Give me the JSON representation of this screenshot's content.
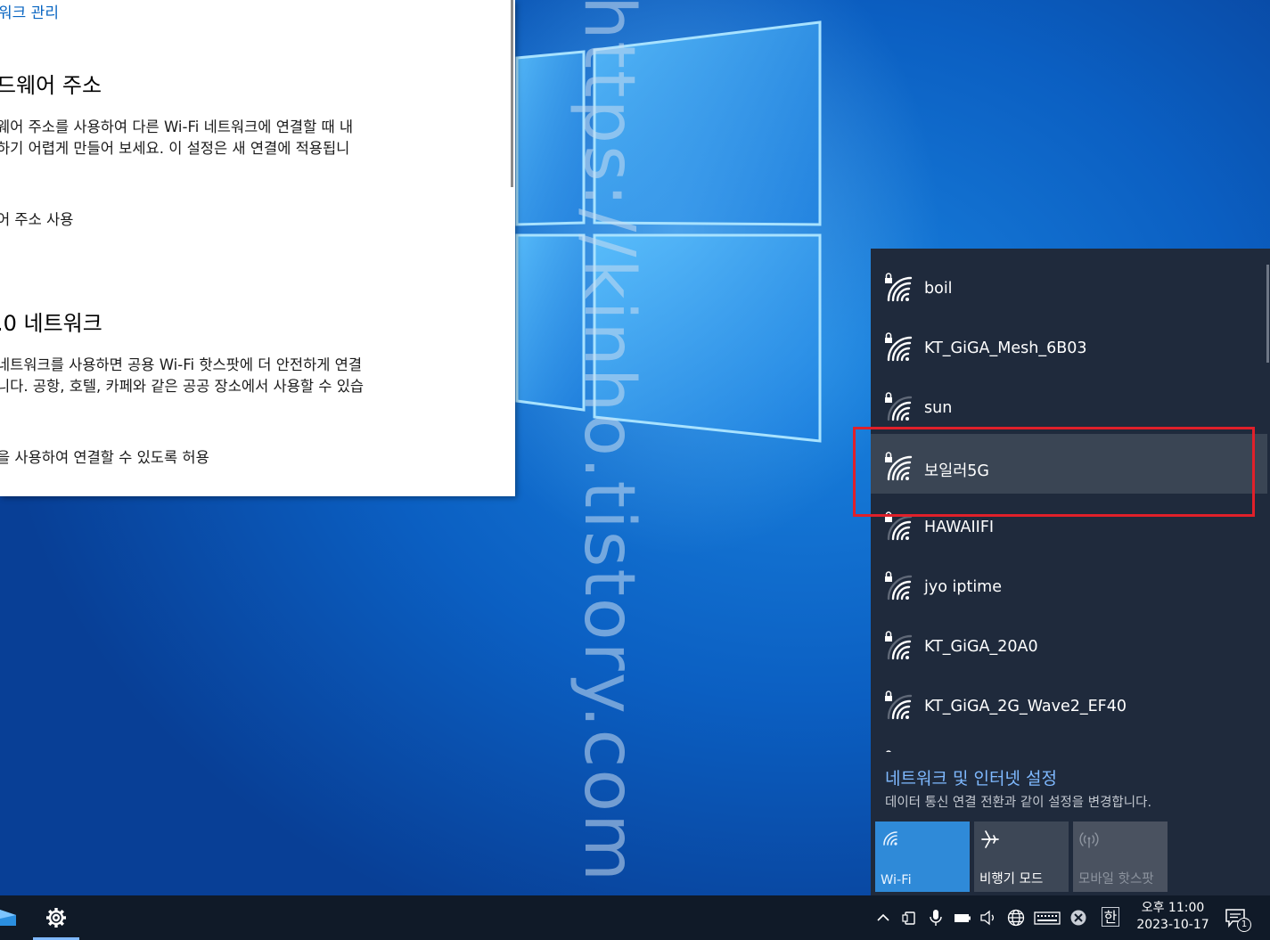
{
  "settings_window": {
    "link": "워크 관리",
    "section1": {
      "title": "드웨어 주소",
      "desc_line1": "웨어 주소를 사용하여 다른 Wi-Fi 네트워크에 연결할 때 내",
      "desc_line2": "하기 어렵게 만들어 보세요. 이 설정은 새 연결에 적용됩니",
      "option": "어 주소 사용"
    },
    "section2": {
      "title": ".0 네트워크",
      "desc_line1": "네트워크를 사용하면 공용 Wi-Fi 핫스팟에 더 안전하게 연결",
      "desc_line2": "니다. 공항, 호텔, 카페와 같은 공공 장소에서 사용할 수 있습",
      "option": "을 사용하여 연결할 수 있도록 허용"
    }
  },
  "watermark": "https://kinho.tistory.com",
  "network_flyout": {
    "networks": [
      {
        "name": "boil",
        "secured": true,
        "signal": 4,
        "selected": false
      },
      {
        "name": "KT_GiGA_Mesh_6B03",
        "secured": true,
        "signal": 4,
        "selected": false
      },
      {
        "name": "sun",
        "secured": true,
        "signal": 3,
        "selected": false
      },
      {
        "name": "보일러5G",
        "secured": true,
        "signal": 4,
        "selected": true
      },
      {
        "name": "HAWAIIFI",
        "secured": true,
        "signal": 3,
        "selected": false
      },
      {
        "name": "jyo iptime",
        "secured": true,
        "signal": 3,
        "selected": false
      },
      {
        "name": "KT_GiGA_20A0",
        "secured": true,
        "signal": 3,
        "selected": false
      },
      {
        "name": "KT_GiGA_2G_Wave2_EF40",
        "secured": true,
        "signal": 3,
        "selected": false
      },
      {
        "name": "",
        "secured": true,
        "signal": 3,
        "selected": false
      }
    ],
    "settings_link": "네트워크 및 인터넷 설정",
    "settings_sub": "데이터 통신 연결 전환과 같이 설정을 변경합니다.",
    "tiles": {
      "wifi": {
        "label": "Wi-Fi",
        "icon": "wifi-icon",
        "state": "on"
      },
      "airplane": {
        "label": "비행기 모드",
        "icon": "airplane-icon",
        "state": "off"
      },
      "hotspot": {
        "label": "모바일 핫스팟",
        "icon": "hotspot-icon",
        "state": "disabled"
      }
    }
  },
  "taskbar": {
    "ime_label": "한",
    "clock": {
      "period_time": "오후 11:00",
      "date": "2023-10-17"
    },
    "notification_count": "1"
  },
  "colors": {
    "flyout_bg": "#1f2a3c",
    "accent": "#2f8ad8",
    "link": "#7fb9ff",
    "highlight": "#e0202a",
    "taskbar_bg": "#101a28"
  }
}
